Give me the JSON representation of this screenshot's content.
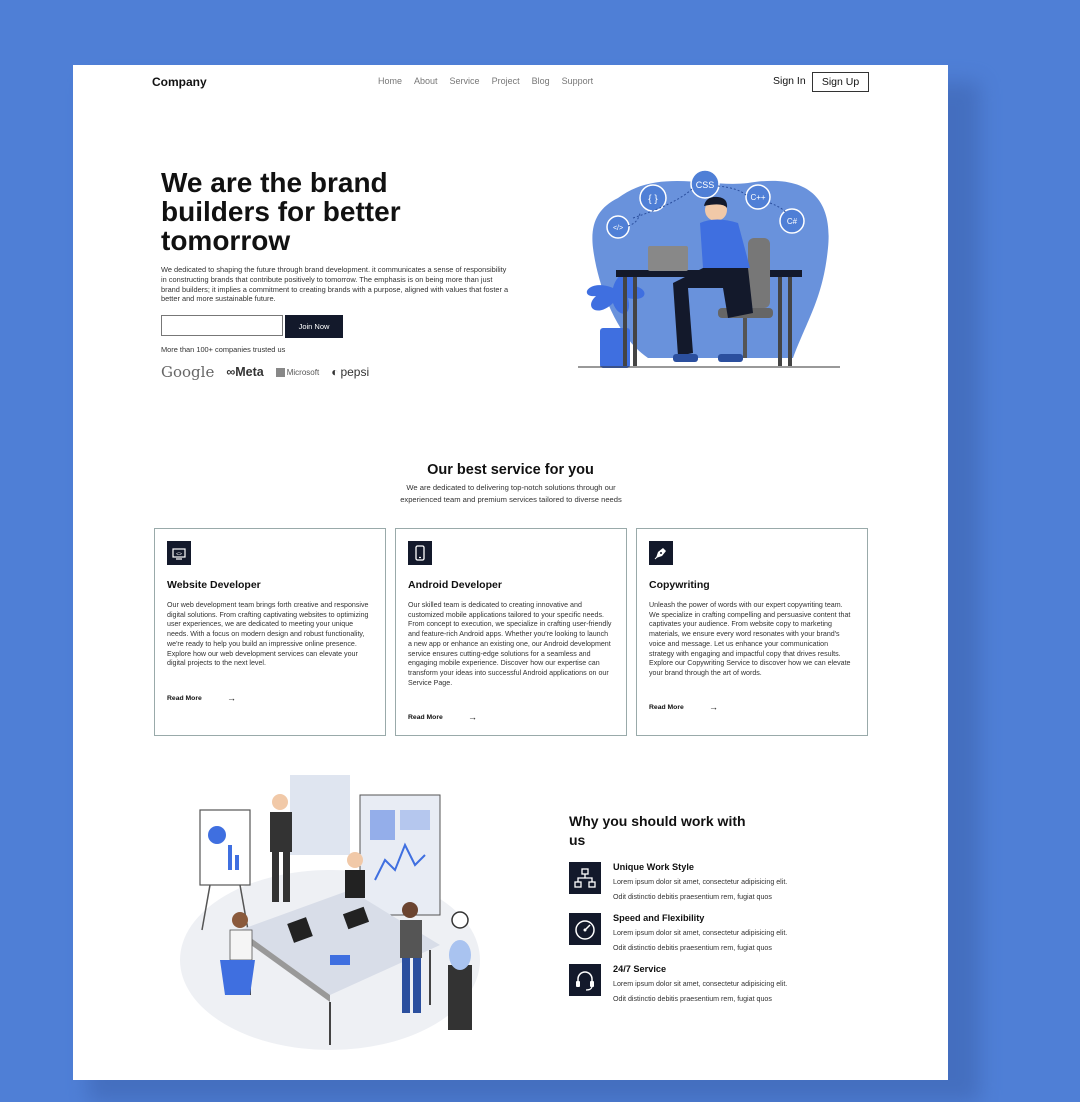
{
  "nav": {
    "brand": "Company",
    "links": [
      "Home",
      "About",
      "Service",
      "Project",
      "Blog",
      "Support"
    ],
    "sign_in": "Sign In",
    "sign_up": "Sign Up"
  },
  "hero": {
    "title": "We are the brand builders for better tomorrow",
    "description": "We dedicated to shaping the future through brand development. it communicates a sense of responsibility in constructing brands that contribute positively to tomorrow. The emphasis is on being more than just brand builders; it implies a commitment to creating brands with a purpose, aligned with values that foster a better and more sustainable future.",
    "email_value": "",
    "join_label": "Join Now",
    "trusted_text": "More than 100+ companies trusted us",
    "logos": [
      "Google",
      "Meta",
      "Microsoft",
      "pepsi"
    ],
    "illustration_labels": [
      "CSS",
      "{ }",
      "C++",
      "C#",
      "</>"
    ]
  },
  "services": {
    "title": "Our best service for you",
    "subtitle": "We are dedicated to delivering top-notch solutions through our experienced team and premium services tailored to diverse needs",
    "cards": [
      {
        "icon": "monitor-code-icon",
        "title": "Website Developer",
        "body": "Our web development team brings forth creative and responsive digital solutions. From crafting captivating websites to optimizing user experiences, we are dedicated to meeting your unique needs. With a focus on modern design and robust functionality, we're ready to help you build an impressive online presence. Explore how our web development services can elevate your digital projects to the next level.",
        "more": "Read More"
      },
      {
        "icon": "smartphone-icon",
        "title": "Android Developer",
        "body": "Our skilled team is dedicated to creating innovative and customized mobile applications tailored to your specific needs. From concept to execution, we specialize in crafting user-friendly and feature-rich Android apps. Whether you're looking to launch a new app or enhance an existing one, our Android development service ensures cutting-edge solutions for a seamless and engaging mobile experience. Discover how our expertise can transform your ideas into successful Android applications on our Service Page.",
        "more": "Read More"
      },
      {
        "icon": "pen-nib-icon",
        "title": "Copywriting",
        "body": "Unleash the power of words with our expert copywriting team. We specialize in crafting compelling and persuasive content that captivates your audience. From website copy to marketing materials, we ensure every word resonates with your brand's voice and message. Let us enhance your communication strategy with engaging and impactful copy that drives results. Explore our Copywriting Service to discover how we can elevate your brand through the art of words.",
        "more": "Read More"
      }
    ]
  },
  "why": {
    "title": "Why you should work with us",
    "features": [
      {
        "icon": "network-icon",
        "title": "Unique Work Style",
        "line1": "Lorem ipsum dolor sit amet, consectetur adipisicing elit.",
        "line2": "Odit distinctio debitis praesentium rem, fugiat quos"
      },
      {
        "icon": "speedometer-icon",
        "title": "Speed and Flexibility",
        "line1": "Lorem ipsum dolor sit amet, consectetur adipisicing elit.",
        "line2": "Odit distinctio debitis praesentium rem, fugiat quos"
      },
      {
        "icon": "headset-icon",
        "title": "24/7 Service",
        "line1": "Lorem ipsum dolor sit amet, consectetur adipisicing elit.",
        "line2": "Odit distinctio debitis praesentium rem, fugiat quos"
      }
    ]
  },
  "colors": {
    "background": "#4f7fd6",
    "dark": "#13192b",
    "accent": "#3f6fe0"
  }
}
